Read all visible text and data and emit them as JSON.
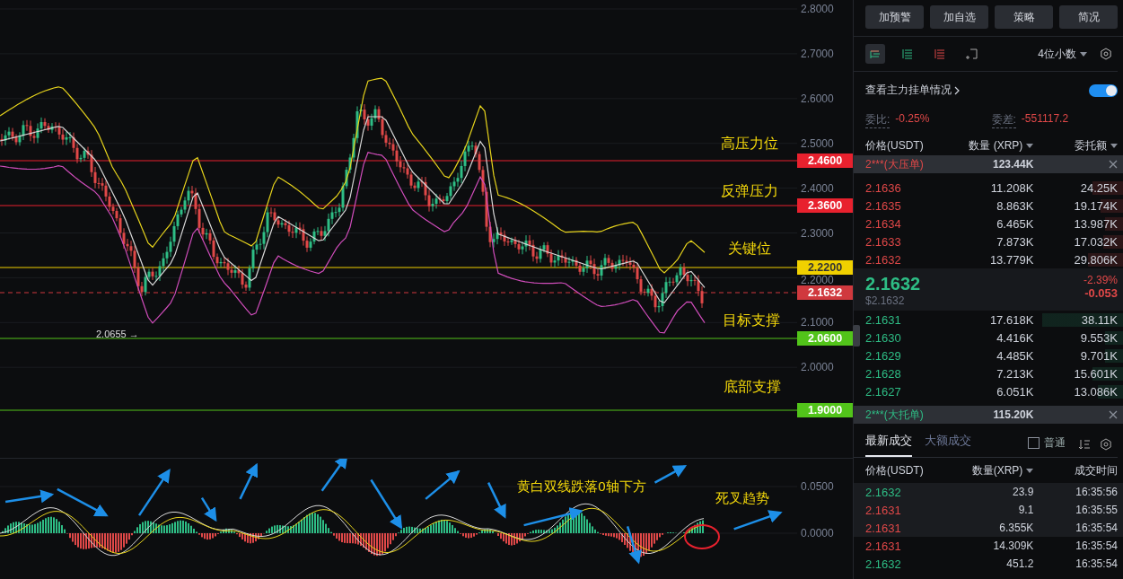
{
  "chart": {
    "yticks": [
      "2.8000",
      "2.7000",
      "2.6000",
      "2.5000",
      "2.4000",
      "2.3000",
      "2.2000",
      "2.1000",
      "2.0000"
    ],
    "low_marker": "2.0655 →",
    "levels": [
      {
        "kind": "level",
        "price": "2.4600",
        "color": "#e8212e",
        "note": "高压力位"
      },
      {
        "kind": "level",
        "price": "2.3600",
        "color": "#e8212e",
        "note": "反弹压力"
      },
      {
        "kind": "level",
        "price": "2.2200",
        "color": "#f0d000",
        "note": "关键位"
      },
      {
        "kind": "current",
        "price": "2.1632",
        "color": "#d0393e"
      },
      {
        "kind": "level",
        "price": "2.0600",
        "color": "#52c41a",
        "note": "目标支撑"
      },
      {
        "kind": "level",
        "price": "1.9000",
        "color": "#52c41a",
        "note": "底部支撑"
      }
    ]
  },
  "macd": {
    "yticks": [
      "0.0500",
      "0.0000"
    ],
    "notes": [
      "黄白双线跌落0轴下方",
      "死叉趋势"
    ]
  },
  "actions": [
    "加预警",
    "加自选",
    "策略",
    "简况"
  ],
  "decimals": "4位小数",
  "main_orders": {
    "label": "查看主力挂单情况",
    "on": true
  },
  "ratio": {
    "label": "委比:",
    "value": "-0.25%"
  },
  "diff": {
    "label": "委差:",
    "value": "-551117.2"
  },
  "book_columns": [
    "价格(USDT)",
    "数量 (XRP)",
    "委托额"
  ],
  "big_ask": {
    "label": "2***(大压单)",
    "amount": "123.44K"
  },
  "asks": [
    {
      "price": "2.1636",
      "qty": "11.208K",
      "total": "24.25K"
    },
    {
      "price": "2.1635",
      "qty": "8.863K",
      "total": "19.174K"
    },
    {
      "price": "2.1634",
      "qty": "6.465K",
      "total": "13.987K"
    },
    {
      "price": "2.1633",
      "qty": "7.873K",
      "total": "17.032K"
    },
    {
      "price": "2.1632",
      "qty": "13.779K",
      "total": "29.806K"
    }
  ],
  "last": {
    "price": "2.1632",
    "usd": "$2.1632",
    "change_pct": "-2.39%",
    "change": "-0.053"
  },
  "bids": [
    {
      "price": "2.1631",
      "qty": "17.618K",
      "total": "38.11K"
    },
    {
      "price": "2.1630",
      "qty": "4.416K",
      "total": "9.553K"
    },
    {
      "price": "2.1629",
      "qty": "4.485K",
      "total": "9.701K"
    },
    {
      "price": "2.1628",
      "qty": "7.213K",
      "total": "15.601K"
    },
    {
      "price": "2.1627",
      "qty": "6.051K",
      "total": "13.086K"
    }
  ],
  "big_bid": {
    "label": "2***(大托单)",
    "amount": "115.20K"
  },
  "trade_tabs": [
    {
      "label": "最新成交",
      "selected": true
    },
    {
      "label": "大额成交",
      "selected": false
    }
  ],
  "normal": {
    "label": "普通",
    "checked": false
  },
  "trade_columns": [
    "价格(USDT)",
    "数量(XRP)",
    "成交时间"
  ],
  "trades": [
    {
      "color": "#2ebd85",
      "price": "2.1632",
      "qty": "23.9",
      "time": "16:35:56"
    },
    {
      "color": "#e04848",
      "price": "2.1631",
      "qty": "9.1",
      "time": "16:35:55"
    },
    {
      "color": "#e04848",
      "price": "2.1631",
      "qty": "6.355K",
      "time": "16:35:54"
    },
    {
      "color": "#e04848",
      "price": "2.1631",
      "qty": "14.309K",
      "time": "16:35:54"
    },
    {
      "color": "#2ebd85",
      "price": "2.1632",
      "qty": "451.2",
      "time": "16:35:54"
    }
  ]
}
